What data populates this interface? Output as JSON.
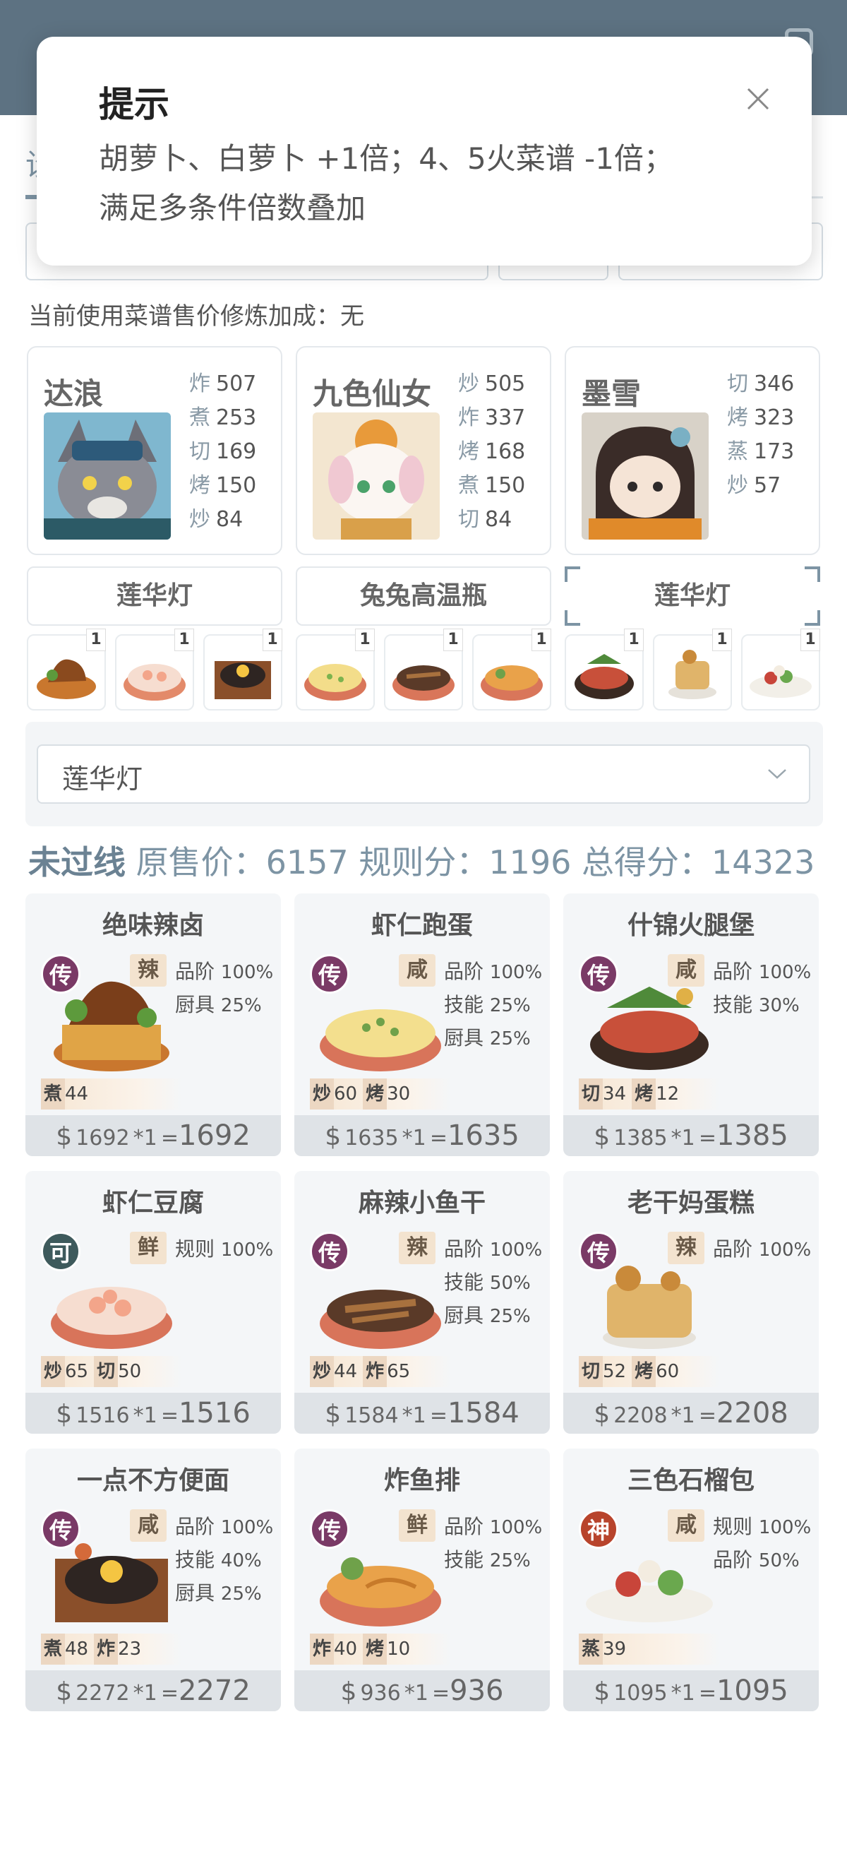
{
  "tip_modal": {
    "title": "提示",
    "line1": "胡萝卜、白萝卜 +1倍；4、5火菜谱 -1倍；",
    "line2": "满足多条件倍数叠加"
  },
  "tab_peek": "设",
  "bonus_line": "当前使用菜谱售价修炼加成：无",
  "chefs": [
    {
      "name": "达浪",
      "stats": [
        {
          "skill": "炸",
          "value": "507"
        },
        {
          "skill": "煮",
          "value": "253"
        },
        {
          "skill": "切",
          "value": "169"
        },
        {
          "skill": "烤",
          "value": "150"
        },
        {
          "skill": "炒",
          "value": "84"
        }
      ]
    },
    {
      "name": "九色仙女",
      "stats": [
        {
          "skill": "炒",
          "value": "505"
        },
        {
          "skill": "炸",
          "value": "337"
        },
        {
          "skill": "烤",
          "value": "168"
        },
        {
          "skill": "煮",
          "value": "150"
        },
        {
          "skill": "切",
          "value": "84"
        }
      ]
    },
    {
      "name": "墨雪",
      "stats": [
        {
          "skill": "切",
          "value": "346"
        },
        {
          "skill": "烤",
          "value": "323"
        },
        {
          "skill": "蒸",
          "value": "173"
        },
        {
          "skill": "炒",
          "value": "57"
        }
      ]
    }
  ],
  "equipment": [
    "莲华灯",
    "兔兔高温瓶",
    "莲华灯"
  ],
  "thumb_counts": [
    "1",
    "1",
    "1",
    "1",
    "1",
    "1",
    "1",
    "1",
    "1"
  ],
  "filter": {
    "selected": "莲华灯"
  },
  "summary": {
    "status": "未过线",
    "base_label": "原售价：",
    "base_value": "6157",
    "rule_label": "规则分：",
    "rule_value": "1196",
    "total_label": "总得分：",
    "total_value": "14323"
  },
  "dishes": [
    {
      "name": "绝味辣卤",
      "rarity": "传",
      "flavor": "辣",
      "buffs": [
        {
          "label": "品阶",
          "pct": "100%"
        },
        {
          "label": "厨具",
          "pct": "25%"
        }
      ],
      "skills": [
        {
          "skill": "煮",
          "value": "44"
        }
      ],
      "price": "1692",
      "mult": "*1",
      "total": "1692"
    },
    {
      "name": "虾仁跑蛋",
      "rarity": "传",
      "flavor": "咸",
      "buffs": [
        {
          "label": "品阶",
          "pct": "100%"
        },
        {
          "label": "技能",
          "pct": "25%"
        },
        {
          "label": "厨具",
          "pct": "25%"
        }
      ],
      "skills": [
        {
          "skill": "炒",
          "value": "60"
        },
        {
          "skill": "烤",
          "value": "30"
        }
      ],
      "price": "1635",
      "mult": "*1",
      "total": "1635"
    },
    {
      "name": "什锦火腿堡",
      "rarity": "传",
      "flavor": "咸",
      "buffs": [
        {
          "label": "品阶",
          "pct": "100%"
        },
        {
          "label": "技能",
          "pct": "30%"
        }
      ],
      "skills": [
        {
          "skill": "切",
          "value": "34"
        },
        {
          "skill": "烤",
          "value": "12"
        }
      ],
      "price": "1385",
      "mult": "*1",
      "total": "1385"
    },
    {
      "name": "虾仁豆腐",
      "rarity": "可",
      "flavor": "鲜",
      "buffs": [
        {
          "label": "规则",
          "pct": "100%"
        }
      ],
      "skills": [
        {
          "skill": "炒",
          "value": "65"
        },
        {
          "skill": "切",
          "value": "50"
        }
      ],
      "price": "1516",
      "mult": "*1",
      "total": "1516"
    },
    {
      "name": "麻辣小鱼干",
      "rarity": "传",
      "flavor": "辣",
      "buffs": [
        {
          "label": "品阶",
          "pct": "100%"
        },
        {
          "label": "技能",
          "pct": "50%"
        },
        {
          "label": "厨具",
          "pct": "25%"
        }
      ],
      "skills": [
        {
          "skill": "炒",
          "value": "44"
        },
        {
          "skill": "炸",
          "value": "65"
        }
      ],
      "price": "1584",
      "mult": "*1",
      "total": "1584"
    },
    {
      "name": "老干妈蛋糕",
      "rarity": "传",
      "flavor": "辣",
      "buffs": [
        {
          "label": "品阶",
          "pct": "100%"
        }
      ],
      "skills": [
        {
          "skill": "切",
          "value": "52"
        },
        {
          "skill": "烤",
          "value": "60"
        }
      ],
      "price": "2208",
      "mult": "*1",
      "total": "2208"
    },
    {
      "name": "一点不方便面",
      "rarity": "传",
      "flavor": "咸",
      "buffs": [
        {
          "label": "品阶",
          "pct": "100%"
        },
        {
          "label": "技能",
          "pct": "40%"
        },
        {
          "label": "厨具",
          "pct": "25%"
        }
      ],
      "skills": [
        {
          "skill": "煮",
          "value": "48"
        },
        {
          "skill": "炸",
          "value": "23"
        }
      ],
      "price": "2272",
      "mult": "*1",
      "total": "2272"
    },
    {
      "name": "炸鱼排",
      "rarity": "传",
      "flavor": "鲜",
      "buffs": [
        {
          "label": "品阶",
          "pct": "100%"
        },
        {
          "label": "技能",
          "pct": "25%"
        }
      ],
      "skills": [
        {
          "skill": "炸",
          "value": "40"
        },
        {
          "skill": "烤",
          "value": "10"
        }
      ],
      "price": "936",
      "mult": "*1",
      "total": "936"
    },
    {
      "name": "三色石榴包",
      "rarity": "神",
      "flavor": "咸",
      "buffs": [
        {
          "label": "规则",
          "pct": "100%"
        },
        {
          "label": "品阶",
          "pct": "50%"
        }
      ],
      "skills": [
        {
          "skill": "蒸",
          "value": "39"
        }
      ],
      "price": "1095",
      "mult": "*1",
      "total": "1095"
    }
  ],
  "currency_symbol": "$",
  "colors": {
    "appbar": "#5d7282",
    "accent": "#7d94a4",
    "rarity_chuan": "#7a3a66",
    "rarity_ke": "#3e5a5c",
    "rarity_shen": "#b8442c"
  }
}
